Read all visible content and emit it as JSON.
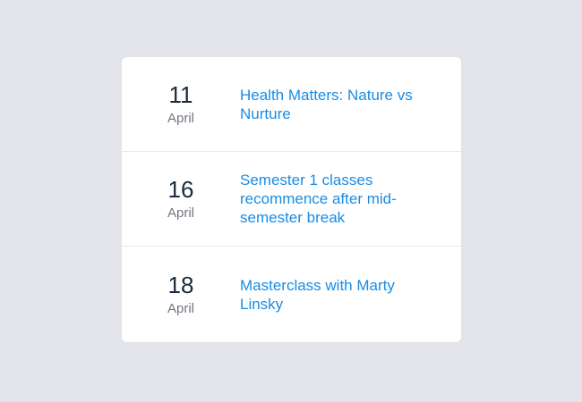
{
  "events": [
    {
      "day": "11",
      "month": "April",
      "title": "Health Matters: Nature vs Nurture"
    },
    {
      "day": "16",
      "month": "April",
      "title": "Semester 1 classes recommence after mid-semester break"
    },
    {
      "day": "18",
      "month": "April",
      "title": "Masterclass with Marty Linsky"
    }
  ]
}
